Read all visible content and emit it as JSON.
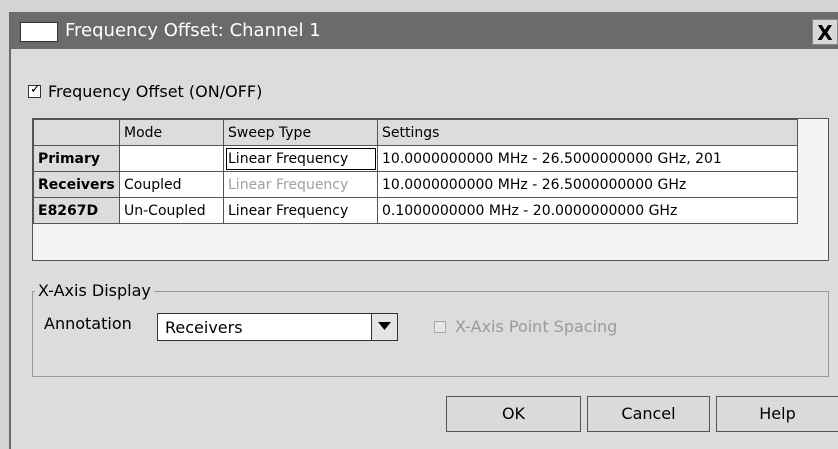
{
  "window": {
    "title": "Frequency Offset: Channel 1",
    "close_label": "X"
  },
  "frequency_offset": {
    "label": "Frequency Offset (ON/OFF)",
    "checked": true
  },
  "table": {
    "columns": [
      "",
      "Mode",
      "Sweep Type",
      "Settings"
    ],
    "rows": [
      {
        "name": "Primary",
        "mode": "",
        "sweep_type": "Linear Frequency",
        "settings": "10.0000000000 MHz - 26.5000000000 GHz, 201"
      },
      {
        "name": "Receivers",
        "mode": "Coupled",
        "sweep_type": "Linear Frequency",
        "settings": "10.0000000000 MHz - 26.5000000000 GHz"
      },
      {
        "name": "E8267D",
        "mode": "Un-Coupled",
        "sweep_type": "Linear Frequency",
        "settings": "0.1000000000 MHz - 20.0000000000 GHz"
      }
    ]
  },
  "x_axis_display": {
    "group_title": "X-Axis Display",
    "annotation_label": "Annotation",
    "annotation_value": "Receivers",
    "point_spacing_label": "X-Axis Point Spacing",
    "point_spacing_checked": false,
    "point_spacing_enabled": false
  },
  "buttons": {
    "ok": "OK",
    "cancel": "Cancel",
    "help": "Help"
  },
  "colors": {
    "titlebar": "#6b6b6b",
    "dialog_background": "#dcdcdc",
    "disabled_text": "#a0a0a0"
  },
  "icons": [
    "check-icon",
    "close-icon",
    "dropdown-arrow-icon"
  ]
}
